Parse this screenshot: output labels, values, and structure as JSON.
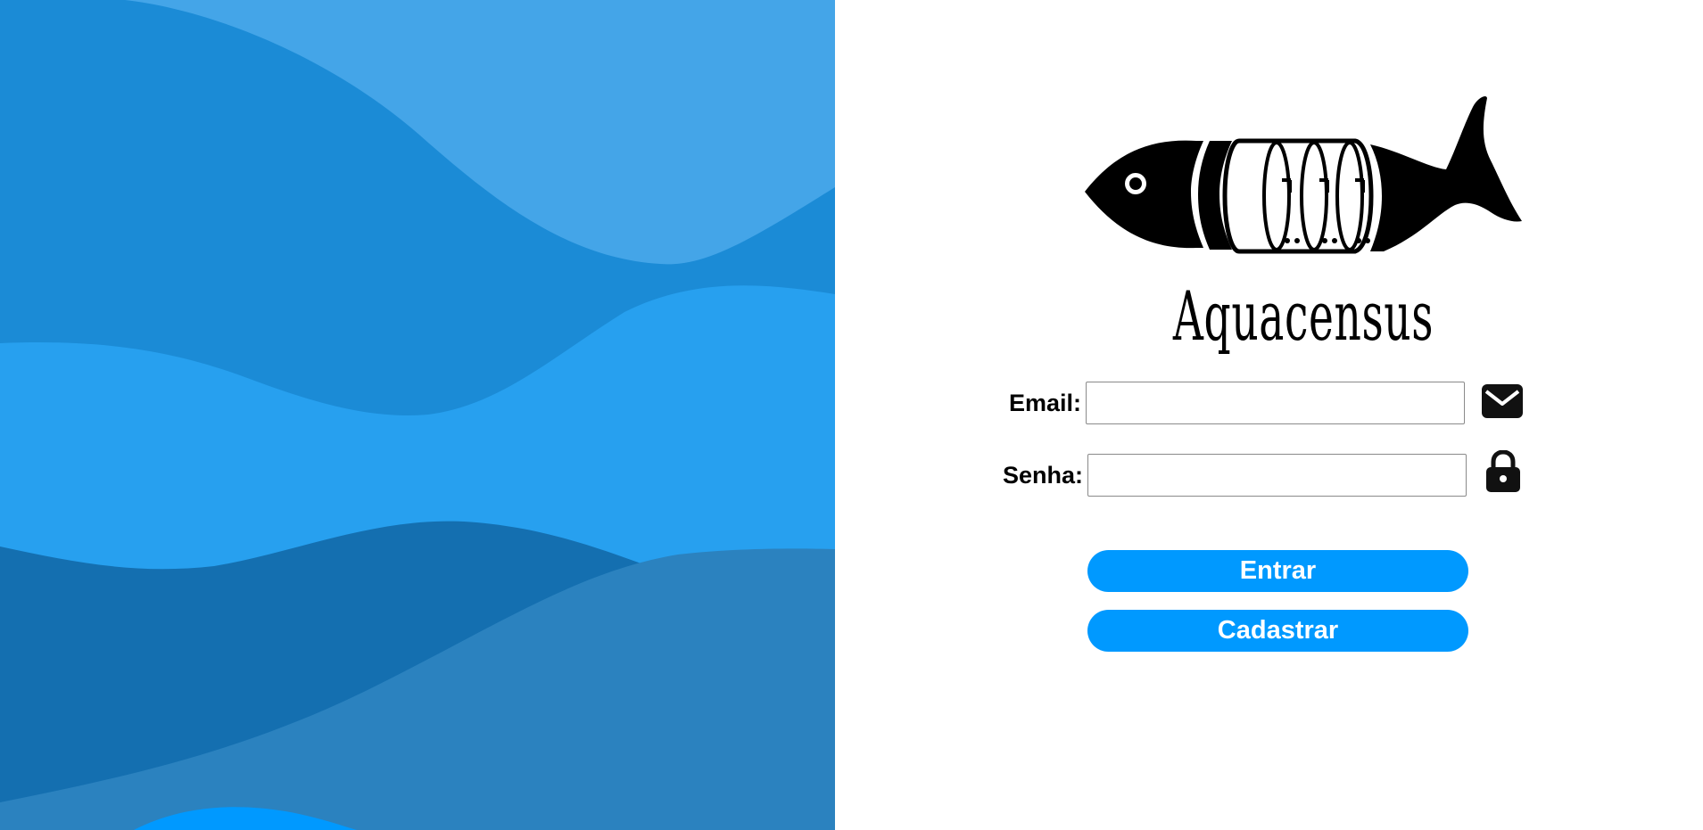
{
  "brand": {
    "name": "Aquacensus",
    "logo_icon": "fish-logo-icon"
  },
  "form": {
    "email_label": "Email:",
    "email_value": "",
    "email_placeholder": "",
    "email_icon": "envelope-icon",
    "password_label": "Senha:",
    "password_value": "",
    "password_placeholder": "",
    "password_icon": "lock-icon"
  },
  "actions": {
    "login_label": "Entrar",
    "register_label": "Cadastrar"
  },
  "colors": {
    "button": "#0099ff",
    "wave_light": "#44a5e8",
    "wave_mid": "#1b8bd6",
    "wave_bright": "#27a0ef",
    "wave_dark": "#146fb0",
    "wave_steel": "#2b82bf"
  }
}
